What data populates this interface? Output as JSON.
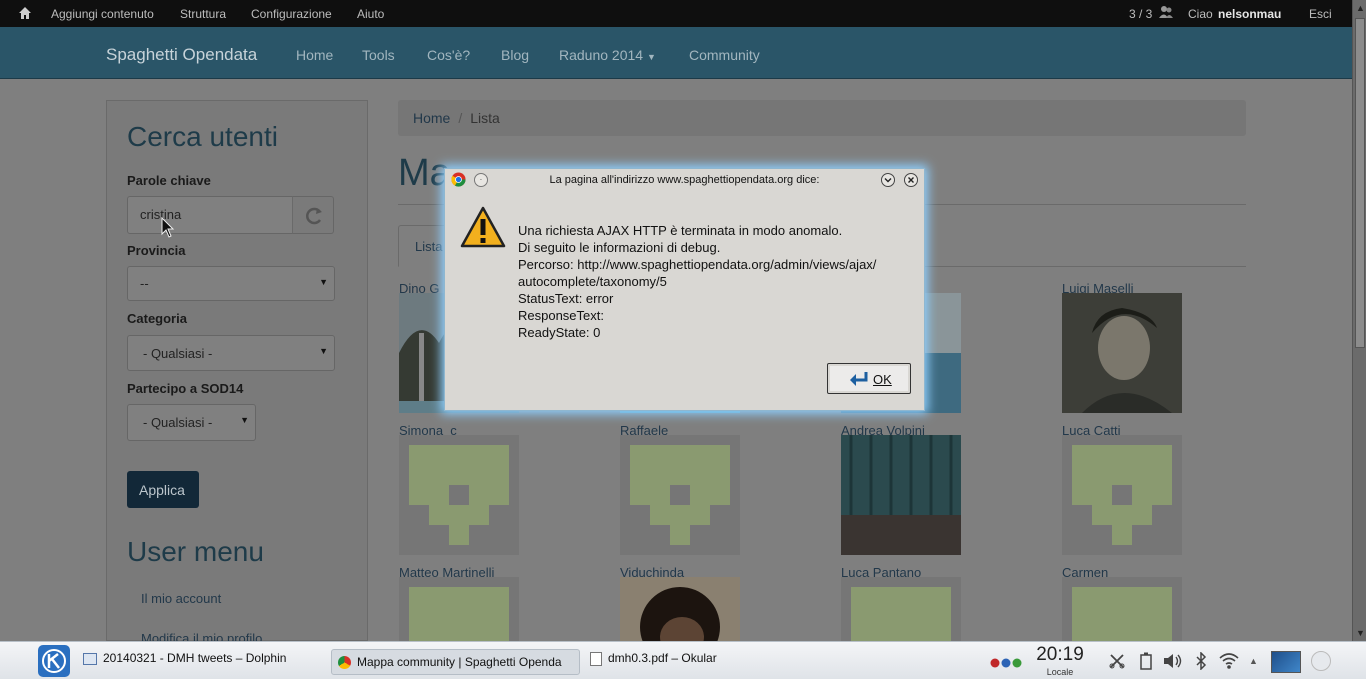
{
  "adminbar": {
    "links": [
      "Aggiungi contenuto",
      "Struttura",
      "Configurazione",
      "Aiuto"
    ],
    "counter": "3 / 3",
    "greeting": "Ciao",
    "username": "nelsonmau",
    "logout": "Esci"
  },
  "navbar": {
    "brand": "Spaghetti Opendata",
    "items": [
      "Home",
      "Tools",
      "Cos'è?",
      "Blog",
      "Raduno 2014",
      "Community"
    ]
  },
  "sidebar": {
    "title": "Cerca utenti",
    "keywords_label": "Parole chiave",
    "keywords_value": "cristina",
    "provincia_label": "Provincia",
    "provincia_value": "--",
    "categoria_label": "Categoria",
    "categoria_value": "- Qualsiasi -",
    "sod_label": "Partecipo a SOD14",
    "sod_value": "- Qualsiasi -",
    "apply": "Applica",
    "usermenu_title": "User menu",
    "usermenu_items": [
      "Il mio account",
      "Modifica il mio profilo"
    ]
  },
  "breadcrumb": {
    "home": "Home",
    "current": "Lista"
  },
  "page_title": "Ma",
  "tab_label": "Lista",
  "users": [
    {
      "name": "Dino G"
    },
    {
      "name": "Luigi Maselli"
    },
    {
      "name": "Simona_c"
    },
    {
      "name": "Raffaele"
    },
    {
      "name": "Andrea Volpini"
    },
    {
      "name": "Luca Catti"
    },
    {
      "name": "Matteo Martinelli"
    },
    {
      "name": "Viduchinda"
    },
    {
      "name": "Luca Pantano"
    },
    {
      "name": "Carmen"
    }
  ],
  "dialog": {
    "title": "La pagina all'indirizzo www.spaghettiopendata.org dice:",
    "line1": "Una richiesta AJAX HTTP è terminata in modo anomalo.",
    "line2": "Di seguito le informazioni di debug.",
    "line3": "Percorso: http://www.spaghettiopendata.org/admin/views/ajax/",
    "line4": "autocomplete/taxonomy/5",
    "line5": "StatusText: error",
    "line6": "ResponseText:",
    "line7": "ReadyState: 0",
    "ok": "OK"
  },
  "taskbar": {
    "tasks": [
      "20140321 - DMH tweets – Dolphin",
      "Mappa community | Spaghetti Openda",
      "dmh0.3.pdf – Okular"
    ],
    "clock": "20:19",
    "locale": "Locale"
  },
  "colors": {
    "accent": "#2a5568",
    "dialog_glow": "#8fd0ff",
    "identicon": "#8a9a70"
  }
}
